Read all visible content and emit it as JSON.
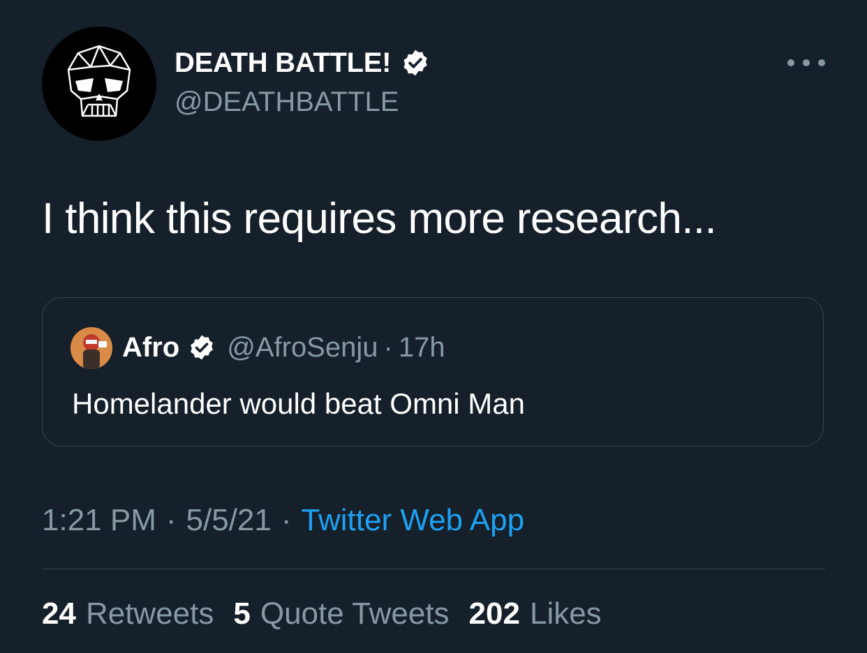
{
  "author": {
    "display_name": "DEATH BATTLE!",
    "handle": "@DEATHBATTLE",
    "verified": true,
    "avatar_icon": "geometric-skull-icon"
  },
  "more_icon": "more-options-icon",
  "tweet": {
    "text": "I think this requires more research..."
  },
  "quoted_tweet": {
    "display_name": "Afro",
    "handle": "@AfroSenju",
    "separator": "·",
    "time": "17h",
    "verified": true,
    "text": "Homelander would beat Omni Man"
  },
  "meta": {
    "time": "1:21 PM",
    "separator": "·",
    "date": "5/5/21",
    "source": "Twitter Web App"
  },
  "stats": [
    {
      "count": "24",
      "label": "Retweets"
    },
    {
      "count": "5",
      "label": "Quote Tweets"
    },
    {
      "count": "202",
      "label": "Likes"
    }
  ],
  "colors": {
    "background": "#15202b",
    "secondary_text": "#8899a6",
    "link": "#1da1f2",
    "border": "#38444d"
  }
}
